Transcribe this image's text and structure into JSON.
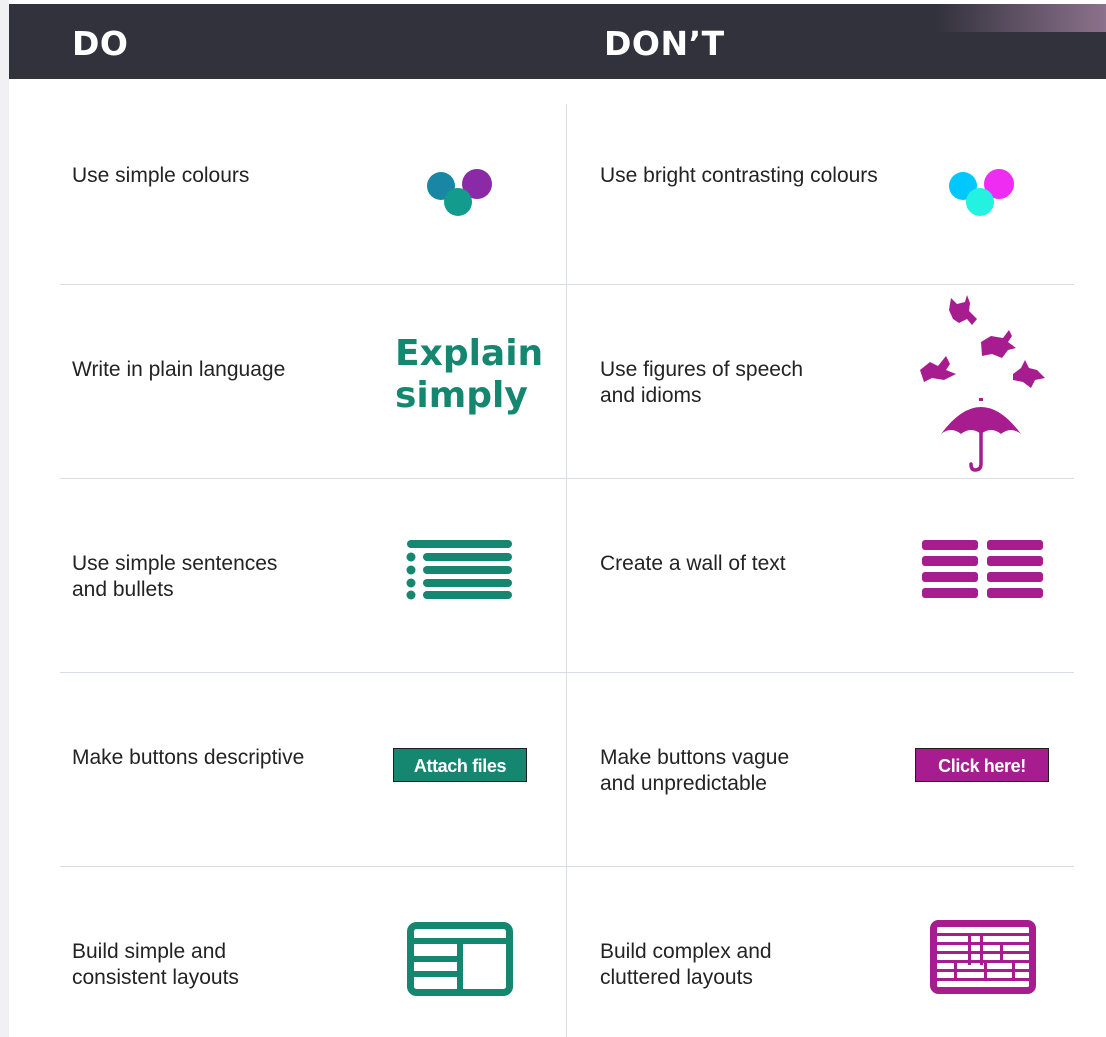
{
  "header": {
    "do_label": "DO",
    "dont_label": "DON’T"
  },
  "colors": {
    "do_accent": "#15866f",
    "dont_accent": "#a71c8e",
    "header_bg": "#32323c"
  },
  "rows": [
    {
      "do": [
        "Use simple colours"
      ],
      "do_icon": "muted-circles-icon",
      "dont": [
        "Use bright contrasting colours"
      ],
      "dont_icon": "bright-circles-icon"
    },
    {
      "do": [
        "Write in plain language"
      ],
      "do_visual": [
        "Explain",
        "simply"
      ],
      "dont": [
        "Use figures of speech",
        "and idioms"
      ],
      "dont_icon": "raining-cats-and-dogs-icon"
    },
    {
      "do": [
        "Use simple sentences",
        "and bullets"
      ],
      "do_icon": "bullet-list-icon",
      "dont": [
        "Create a wall of text"
      ],
      "dont_icon": "wall-of-text-icon"
    },
    {
      "do": [
        "Make buttons descriptive"
      ],
      "do_button": "Attach files",
      "dont": [
        "Make buttons vague",
        "and unpredictable"
      ],
      "dont_button": "Click here!"
    },
    {
      "do": [
        "Build simple and",
        "consistent layouts"
      ],
      "do_icon": "simple-layout-icon",
      "dont": [
        "Build complex and",
        "cluttered layouts"
      ],
      "dont_icon": "cluttered-layout-icon"
    }
  ]
}
